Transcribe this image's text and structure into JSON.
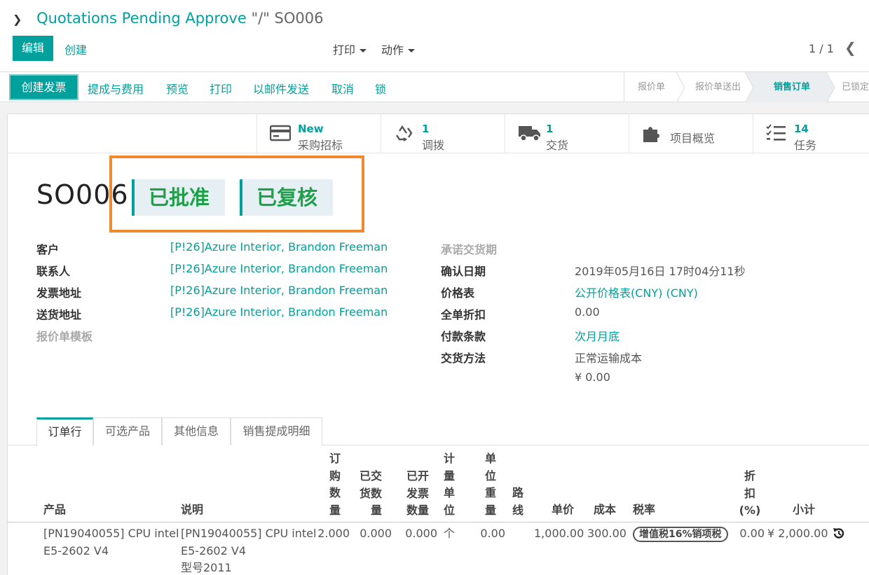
{
  "breadcrumb": {
    "parent": "Quotations Pending Approve",
    "separator": "\"/\"",
    "current": "SO006"
  },
  "control_panel": {
    "edit_label": "编辑",
    "create_label": "创建",
    "print_label": "打印",
    "action_label": "动作",
    "pager": "1 / 1"
  },
  "statusbar": {
    "buttons": [
      "创建发票",
      "提成与费用",
      "预览",
      "打印",
      "以邮件发送",
      "取消",
      "锁"
    ],
    "stages": [
      "报价单",
      "报价单送出",
      "销售订单",
      "已锁定"
    ],
    "active_stage": "销售订单"
  },
  "smart_buttons": [
    {
      "value": "New",
      "label": "采购招标",
      "icon": "credit-card-icon"
    },
    {
      "value": "1",
      "label": "调拨",
      "icon": "recycle-icon"
    },
    {
      "value": "1",
      "label": "交货",
      "icon": "truck-icon"
    },
    {
      "value": "",
      "label": "项目概览",
      "icon": "puzzle-icon"
    },
    {
      "value": "14",
      "label": "任务",
      "icon": "tasks-icon"
    }
  ],
  "record": {
    "name": "SO006",
    "ribbons": [
      "已批准",
      "已复核"
    ]
  },
  "left_fields": [
    {
      "label": "客户",
      "value": "[P!26]Azure Interior, Brandon Freeman"
    },
    {
      "label": "联系人",
      "value": "[P!26]Azure Interior, Brandon Freeman"
    },
    {
      "label": "发票地址",
      "value": "[P!26]Azure Interior, Brandon Freeman"
    },
    {
      "label": "送货地址",
      "value": "[P!26]Azure Interior, Brandon Freeman"
    },
    {
      "label": "报价单模板",
      "value": ""
    }
  ],
  "right_fields": [
    {
      "label": "承诺交货期",
      "value": ""
    },
    {
      "label": "确认日期",
      "value": "2019年05月16日 17时04分11秒"
    },
    {
      "label": "价格表",
      "value": "公开价格表(CNY) (CNY)"
    },
    {
      "label": "全单折扣",
      "value": "0.00"
    },
    {
      "label": "付款条款",
      "value": "次月月底"
    },
    {
      "label": "交货方法",
      "value": "正常运输成本"
    },
    {
      "label": "",
      "value": "¥ 0.00"
    }
  ],
  "tabs": [
    "订单行",
    "可选产品",
    "其他信息",
    "销售提成明细"
  ],
  "table": {
    "headers": {
      "product": "产品",
      "description": "说明",
      "qty_ordered": [
        "订",
        "购",
        "数",
        "量"
      ],
      "qty_delivered": [
        "已交",
        "货数",
        "量"
      ],
      "qty_invoiced": [
        "已开",
        "发票",
        "数量"
      ],
      "uom": [
        "计",
        "量",
        "单",
        "位"
      ],
      "unit_weight": [
        "单",
        "位",
        "重",
        "量"
      ],
      "route": [
        "路",
        "线"
      ],
      "price": "单价",
      "cost": "成本",
      "tax": "税率",
      "discount": [
        "折",
        "扣",
        "(%)"
      ],
      "subtotal": "小计"
    },
    "rows": [
      {
        "product": [
          "[PN19040055] CPU intel",
          "E5-2602 V4"
        ],
        "description": [
          "[PN19040055] CPU intel",
          "E5-2602 V4",
          "型号2011"
        ],
        "qty_ordered": "2.000",
        "qty_delivered": "0.000",
        "qty_invoiced": "0.000",
        "uom": "个",
        "unit_weight": "0.00",
        "route": "",
        "price": "1,000.00",
        "cost": "300.00",
        "tax": "增值税16%销项税",
        "discount": "0.00",
        "subtotal": "¥ 2,000.00"
      }
    ]
  },
  "colors": {
    "primary": "#00a09d",
    "ribbon_text": "#21a04b",
    "highlight": "#f08a30"
  }
}
